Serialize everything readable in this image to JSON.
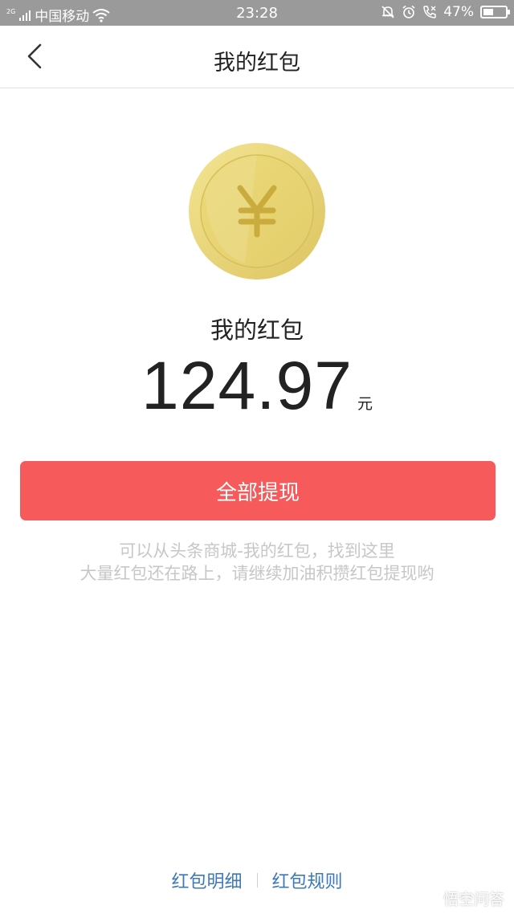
{
  "status_bar": {
    "network_type": "2G",
    "carrier": "中国移动",
    "time": "23:28",
    "battery_percent": "47%",
    "battery_level": 0.47
  },
  "nav": {
    "title": "我的红包"
  },
  "wallet": {
    "label": "我的红包",
    "amount": "124.97",
    "unit": "元"
  },
  "actions": {
    "withdraw_all": "全部提现"
  },
  "tips": {
    "line1": "可以从头条商城-我的红包，找到这里",
    "line2": "大量红包还在路上，请继续加油积攒红包提现哟"
  },
  "footer": {
    "details_link": "红包明细",
    "rules_link": "红包规则"
  },
  "watermark": {
    "text": "悟空问答"
  },
  "colors": {
    "status_bar_bg": "#9a9a9a",
    "accent_button": "#f65a5b",
    "link": "#3d78b8",
    "coin_gold": "#e8d373"
  }
}
